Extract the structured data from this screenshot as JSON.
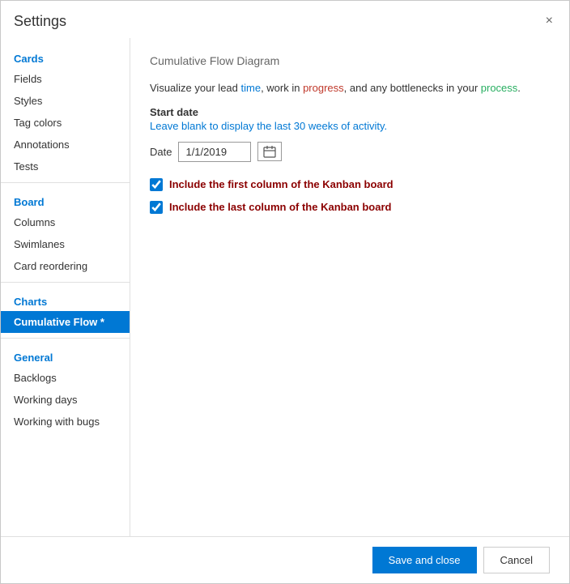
{
  "dialog": {
    "title": "Settings",
    "close_label": "×"
  },
  "sidebar": {
    "sections": [
      {
        "label": "Cards",
        "items": [
          {
            "id": "fields",
            "label": "Fields",
            "active": false
          },
          {
            "id": "styles",
            "label": "Styles",
            "active": false
          },
          {
            "id": "tag-colors",
            "label": "Tag colors",
            "active": false
          },
          {
            "id": "annotations",
            "label": "Annotations",
            "active": false
          },
          {
            "id": "tests",
            "label": "Tests",
            "active": false
          }
        ]
      },
      {
        "label": "Board",
        "items": [
          {
            "id": "columns",
            "label": "Columns",
            "active": false
          },
          {
            "id": "swimlanes",
            "label": "Swimlanes",
            "active": false
          },
          {
            "id": "card-reordering",
            "label": "Card reordering",
            "active": false
          }
        ]
      },
      {
        "label": "Charts",
        "items": [
          {
            "id": "cumulative-flow",
            "label": "Cumulative Flow *",
            "active": true
          }
        ]
      },
      {
        "label": "General",
        "items": [
          {
            "id": "backlogs",
            "label": "Backlogs",
            "active": false
          },
          {
            "id": "working-days",
            "label": "Working days",
            "active": false
          },
          {
            "id": "working-with-bugs",
            "label": "Working with bugs",
            "active": false
          }
        ]
      }
    ]
  },
  "content": {
    "title": "Cumulative Flow Diagram",
    "description_parts": [
      {
        "text": "Visualize your lead ",
        "style": "normal"
      },
      {
        "text": "time",
        "style": "blue"
      },
      {
        "text": ", work in ",
        "style": "normal"
      },
      {
        "text": "progress",
        "style": "red"
      },
      {
        "text": ", and any bottlenecks in your ",
        "style": "normal"
      },
      {
        "text": "process",
        "style": "green"
      },
      {
        "text": ".",
        "style": "normal"
      }
    ],
    "start_date_label": "Start date",
    "start_date_hint": "Leave blank to display the last 30 weeks of activity.",
    "date_label": "Date",
    "date_value": "1/1/2019",
    "checkbox1_label": "Include the first column of the Kanban board",
    "checkbox1_checked": true,
    "checkbox2_label": "Include the last column of the Kanban board",
    "checkbox2_checked": true
  },
  "footer": {
    "save_label": "Save and close",
    "cancel_label": "Cancel"
  }
}
